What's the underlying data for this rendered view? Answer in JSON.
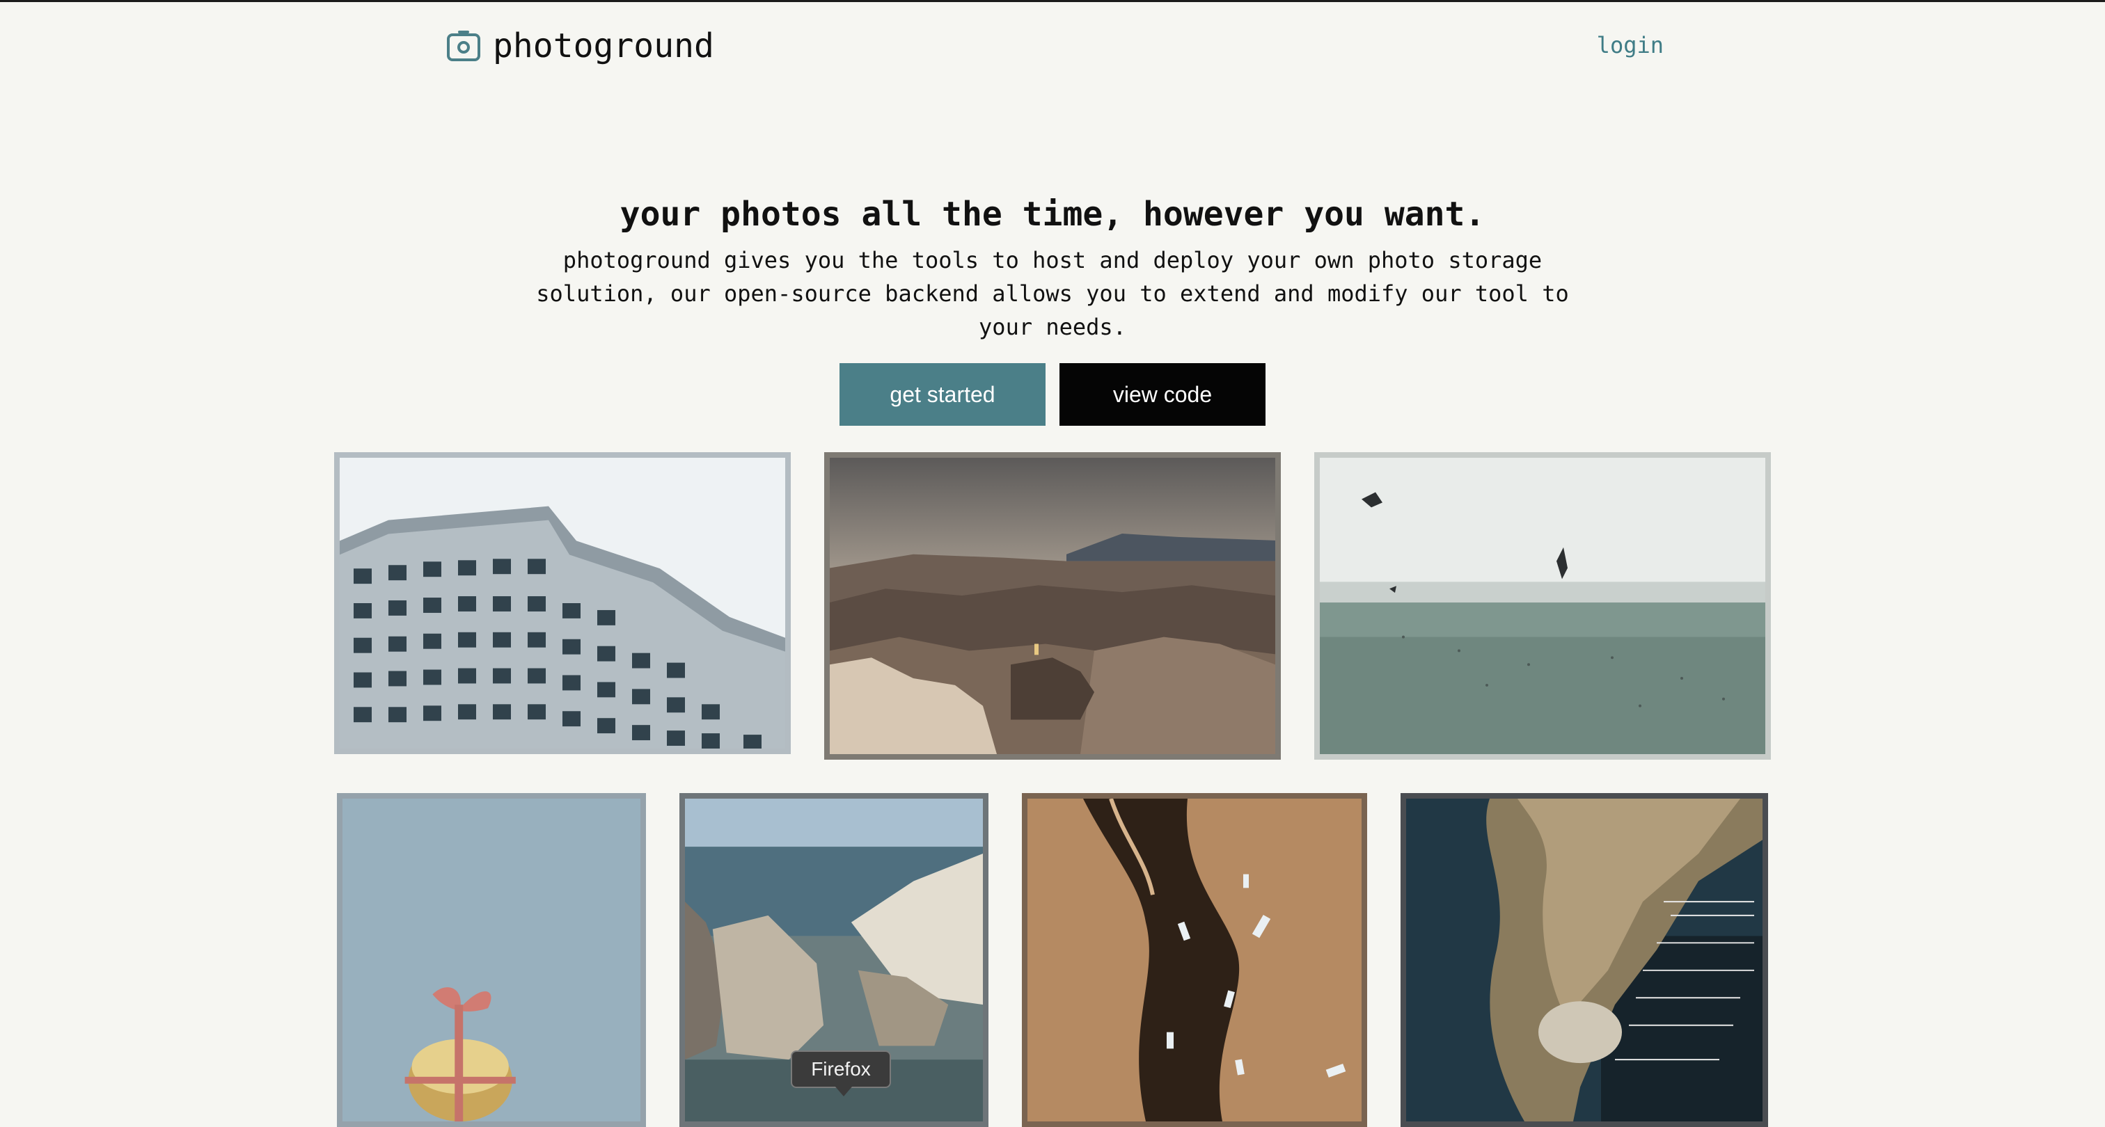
{
  "header": {
    "brand": "photoground",
    "login_label": "login",
    "icon": "camera-icon"
  },
  "hero": {
    "headline": "your photos all the time, however you want.",
    "subtext": "photoground gives you the tools to host and deploy your own photo storage solution, our open-source backend allows you to extend and modify our tool to your needs.",
    "primary_button": "get started",
    "secondary_button": "view code"
  },
  "tooltip": {
    "label": "Firefox"
  },
  "colors": {
    "accent": "#4b7f88",
    "dark": "#050505",
    "background": "#f6f6f2"
  }
}
